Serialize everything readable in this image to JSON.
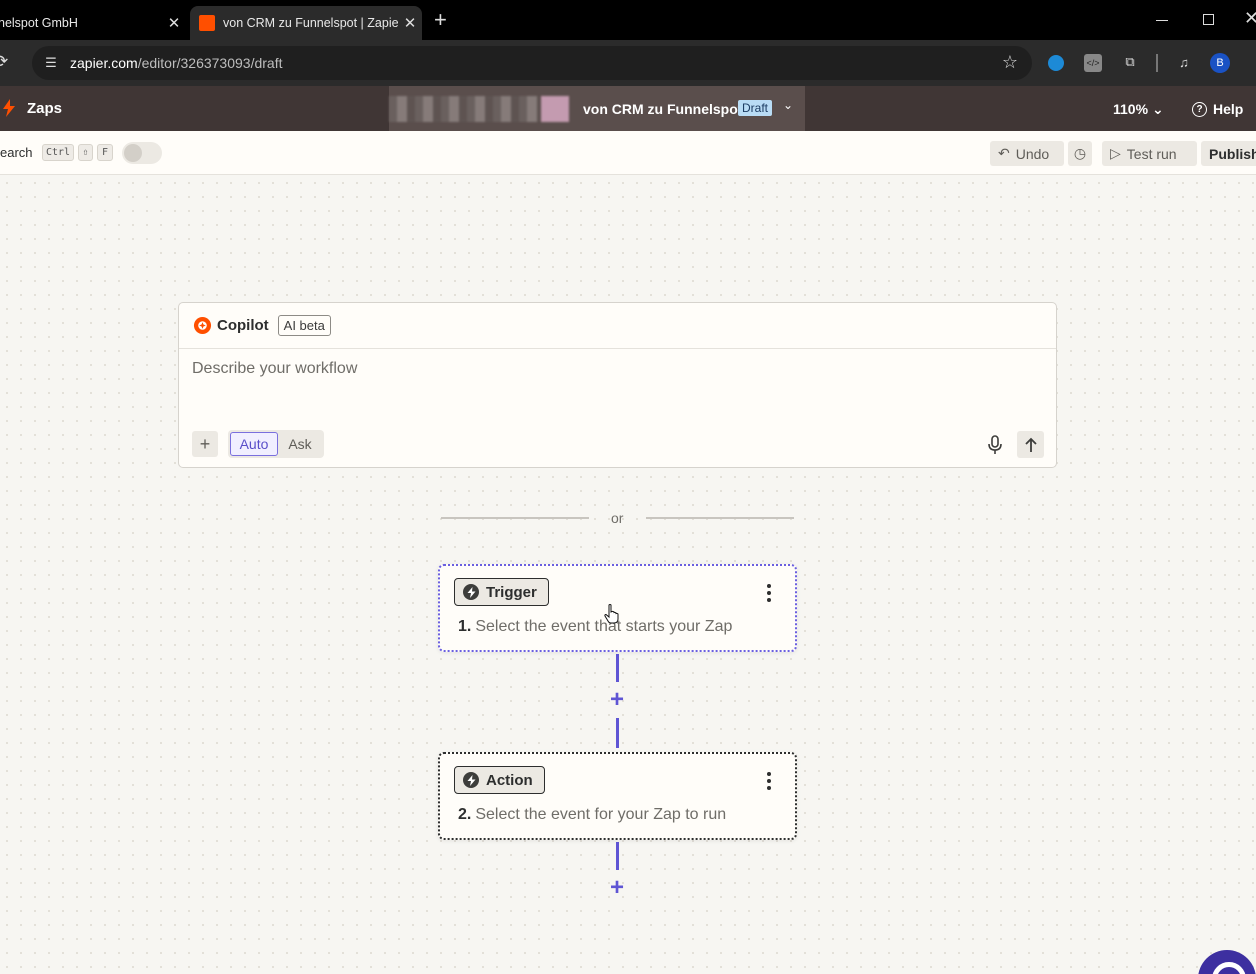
{
  "browser": {
    "tabs": [
      {
        "title": "nelspot GmbH"
      },
      {
        "title": "von CRM zu Funnelspot | Zapier"
      }
    ],
    "address": {
      "host": "zapier.com",
      "path": "/editor/326373093/draft"
    },
    "profile_initial": "B"
  },
  "header": {
    "app_label": "Zaps",
    "zap_name": "von CRM zu Funnelspot",
    "status_badge": "Draft",
    "zoom": "110%",
    "help_label": "Help"
  },
  "toolbar": {
    "search_label": "earch",
    "shortcut_ctrl": "Ctrl",
    "shortcut_shift": "⇧",
    "shortcut_key": "F",
    "undo_label": "Undo",
    "test_run_label": "Test run",
    "publish_label": "Publish"
  },
  "copilot": {
    "title": "Copilot",
    "badge": "AI beta",
    "placeholder": "Describe your workflow",
    "mode_auto": "Auto",
    "mode_ask": "Ask",
    "selected_mode": "Auto"
  },
  "divider_text": "or",
  "steps": [
    {
      "badge": "Trigger",
      "number": "1.",
      "description": "Select the event that starts your Zap"
    },
    {
      "badge": "Action",
      "number": "2.",
      "description": "Select the event for your Zap to run"
    }
  ],
  "colors": {
    "brand_orange": "#ff4f00",
    "header_bg": "#403635",
    "accent_purple": "#5f55d4",
    "draft_badge_bg": "#b9dcf5"
  }
}
